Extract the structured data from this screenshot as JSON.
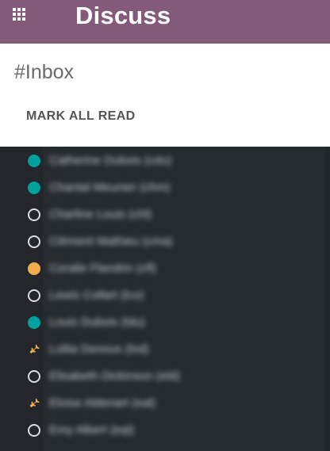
{
  "header": {
    "app_title": "Discuss",
    "apps_menu_icon": "grid-icon"
  },
  "control_panel": {
    "channel_name": "#Inbox",
    "mark_all_read": "MARK ALL READ"
  },
  "colors": {
    "topbar": "#845a7b",
    "online": "#00a09d",
    "away": "#f0ad4e",
    "offline": "#d8dde3",
    "panel_bg": "#262b30"
  },
  "contacts": [
    {
      "name": "Catherine Dubois (cdu)",
      "status": "online"
    },
    {
      "name": "Chantal Meunier (chm)",
      "status": "online"
    },
    {
      "name": "Charline Louis (chl)",
      "status": "offline"
    },
    {
      "name": "Clément Mathieu (cma)",
      "status": "offline"
    },
    {
      "name": "Coralie Flandrin (cfl)",
      "status": "away"
    },
    {
      "name": "Lewis Collart (lco)",
      "status": "offline"
    },
    {
      "name": "Louis Dubois (ldu)",
      "status": "online"
    },
    {
      "name": "Lolita Denous (lod)",
      "status": "leave"
    },
    {
      "name": "Elisabeth Dickinson (eld)",
      "status": "offline"
    },
    {
      "name": "Eloise Aldenart (eal)",
      "status": "leave"
    },
    {
      "name": "Emy Albert (eqt)",
      "status": "offline"
    }
  ]
}
